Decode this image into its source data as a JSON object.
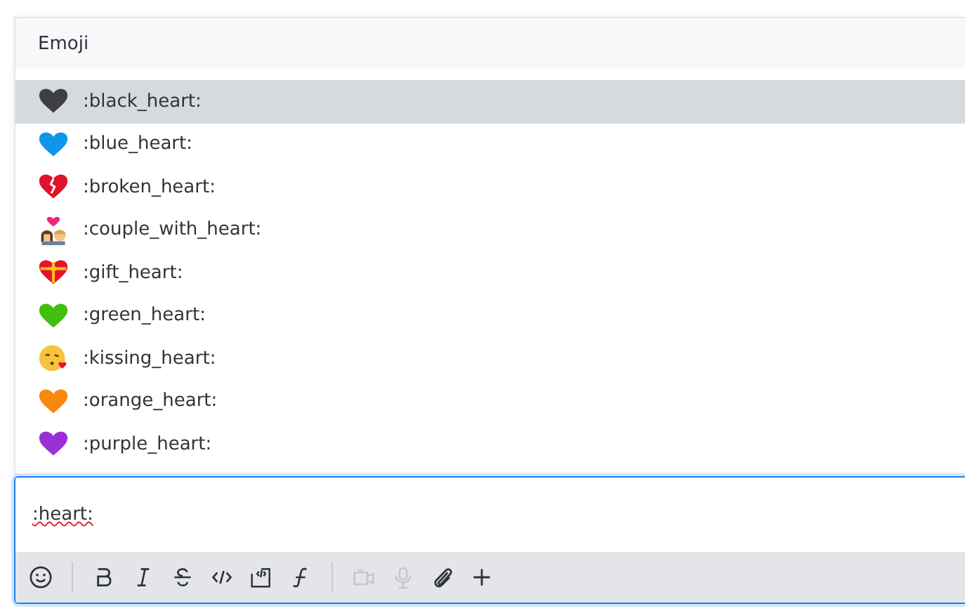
{
  "popup": {
    "header": "Emoji",
    "items": [
      {
        "name": ":black_heart:",
        "kind": "heart",
        "color": "#3d3f44",
        "selected": true
      },
      {
        "name": ":blue_heart:",
        "kind": "heart",
        "color": "#0f96e8",
        "selected": false
      },
      {
        "name": ":broken_heart:",
        "kind": "broken",
        "color": "#e0112a",
        "selected": false
      },
      {
        "name": ":couple_with_heart:",
        "kind": "couple",
        "color": "#f0247c",
        "selected": false
      },
      {
        "name": ":gift_heart:",
        "kind": "gift",
        "color": "#e8112a",
        "selected": false
      },
      {
        "name": ":green_heart:",
        "kind": "heart",
        "color": "#3fbf0e",
        "selected": false
      },
      {
        "name": ":kissing_heart:",
        "kind": "kissing",
        "color": "#f7c33b",
        "selected": false
      },
      {
        "name": ":orange_heart:",
        "kind": "heart",
        "color": "#f7890f",
        "selected": false
      },
      {
        "name": ":purple_heart:",
        "kind": "heart",
        "color": "#9b2fd6",
        "selected": false
      }
    ]
  },
  "composer": {
    "value": ":heart:",
    "toolbar": [
      {
        "kind": "emoji",
        "disabled": false
      },
      {
        "kind": "sep"
      },
      {
        "kind": "bold",
        "disabled": false
      },
      {
        "kind": "italic",
        "disabled": false
      },
      {
        "kind": "strike",
        "disabled": false
      },
      {
        "kind": "code",
        "disabled": false
      },
      {
        "kind": "codeblock",
        "disabled": false
      },
      {
        "kind": "formula",
        "disabled": false
      },
      {
        "kind": "sep"
      },
      {
        "kind": "video",
        "disabled": true
      },
      {
        "kind": "mic",
        "disabled": true
      },
      {
        "kind": "attach",
        "disabled": false
      },
      {
        "kind": "plus",
        "disabled": false
      }
    ]
  }
}
